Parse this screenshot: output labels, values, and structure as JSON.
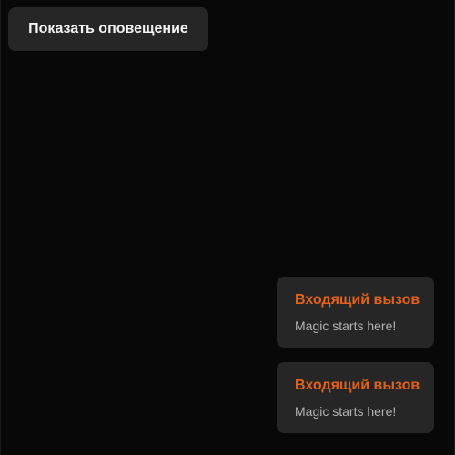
{
  "toolbar": {
    "show_notification_label": "Показать оповещение"
  },
  "toasts": [
    {
      "title": "Входящий вызов",
      "message": "Magic starts here!"
    },
    {
      "title": "Входящий вызов",
      "message": "Magic starts here!"
    }
  ],
  "colors": {
    "background": "#080808",
    "button_bg": "#262626",
    "toast_bg": "#262626",
    "toast_title": "#e0621e",
    "toast_message": "#b3b3b3",
    "button_text": "#f2f2f2"
  }
}
